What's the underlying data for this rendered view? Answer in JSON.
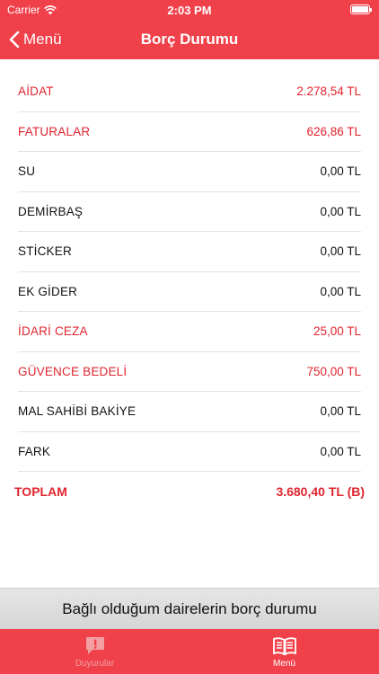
{
  "status_bar": {
    "carrier": "Carrier",
    "time": "2:03 PM"
  },
  "nav": {
    "back_label": "Menü",
    "title": "Borç Durumu"
  },
  "colors": {
    "brand_red": "#f0404a",
    "highlight_red": "#e0242e"
  },
  "items": [
    {
      "label": "AİDAT",
      "value": "2.278,54 TL",
      "highlight": true
    },
    {
      "label": "FATURALAR",
      "value": "626,86 TL",
      "highlight": true
    },
    {
      "label": "SU",
      "value": "0,00 TL",
      "highlight": false
    },
    {
      "label": "DEMİRBAŞ",
      "value": "0,00 TL",
      "highlight": false
    },
    {
      "label": "STİCKER",
      "value": "0,00 TL",
      "highlight": false
    },
    {
      "label": "EK GİDER",
      "value": "0,00 TL",
      "highlight": false
    },
    {
      "label": "İDARİ CEZA",
      "value": "25,00 TL",
      "highlight": true
    },
    {
      "label": "GÜVENCE BEDELİ",
      "value": "750,00 TL",
      "highlight": true
    },
    {
      "label": "MAL SAHİBİ BAKİYE",
      "value": "0,00 TL",
      "highlight": false
    },
    {
      "label": "FARK",
      "value": "0,00 TL",
      "highlight": false
    }
  ],
  "total": {
    "label": "TOPLAM",
    "value": "3.680,40 TL (B)"
  },
  "banner": {
    "text": "Bağlı olduğum dairelerin borç durumu"
  },
  "tabs": [
    {
      "label": "Duyurular",
      "icon": "announcement-icon",
      "active": false
    },
    {
      "label": "Menü",
      "icon": "book-icon",
      "active": true
    }
  ]
}
